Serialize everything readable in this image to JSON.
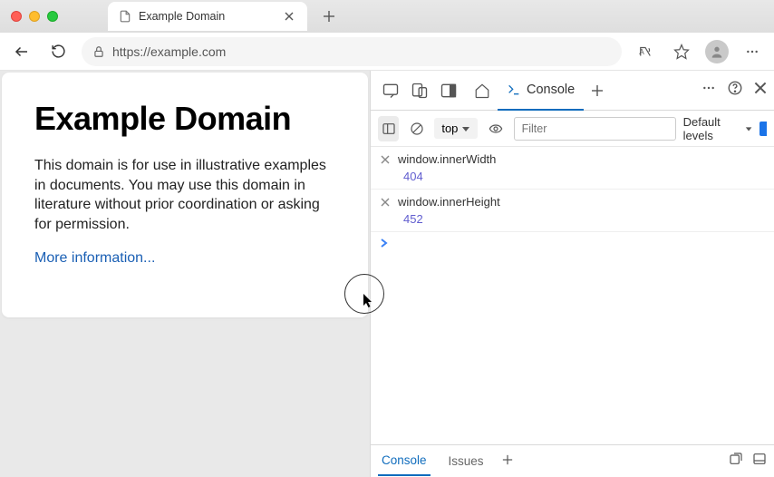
{
  "tab": {
    "title": "Example Domain"
  },
  "address": {
    "url": "https://example.com"
  },
  "page": {
    "heading": "Example Domain",
    "body": "This domain is for use in illustrative examples in documents. You may use this domain in literature without prior coordination or asking for permission.",
    "link": "More information..."
  },
  "devtools": {
    "active_tab": "Console",
    "context": "top",
    "filter_placeholder": "Filter",
    "levels_label": "Default levels",
    "entries": [
      {
        "input": "window.innerWidth",
        "output": "404"
      },
      {
        "input": "window.innerHeight",
        "output": "452"
      }
    ],
    "drawer": {
      "console_label": "Console",
      "issues_label": "Issues"
    }
  }
}
